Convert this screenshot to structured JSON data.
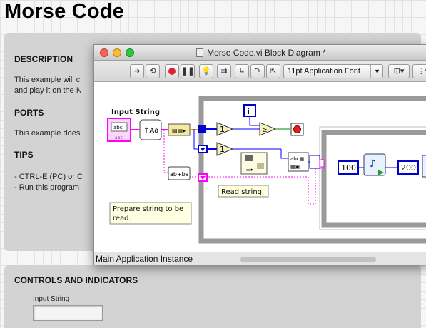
{
  "page": {
    "title": "Morse Code"
  },
  "front_panel": {
    "sections": [
      {
        "heading": "DESCRIPTION",
        "lines": [
          "This example will c",
          "and play it on the N"
        ]
      },
      {
        "heading": "PORTS",
        "lines": [
          "This example does"
        ]
      },
      {
        "heading": "TIPS",
        "lines": [
          "- CTRL-E (PC) or C",
          "- Run this program"
        ]
      }
    ]
  },
  "controls": {
    "heading": "CONTROLS AND INDICATORS",
    "input_label": "Input String",
    "input_value": ""
  },
  "window": {
    "title": "Morse Code.vi Block Diagram *",
    "font_select": "11pt Application Font",
    "status": "Main Application Instance"
  },
  "diagram": {
    "input_label": "Input String",
    "comment_prepare": "Prepare string to be read.",
    "comment_read": "Read string.",
    "const_100": "100",
    "const_200": "200",
    "constant_1a": "1",
    "constant_1b": "1",
    "index_label": "i",
    "control_glyph": "abc",
    "string_glyph": "abc"
  },
  "colors": {
    "string_wire": "#ff00ff",
    "numeric_wire": "#0000ff",
    "boolean_wire": "#008000",
    "frame": "#9a9a9a"
  }
}
